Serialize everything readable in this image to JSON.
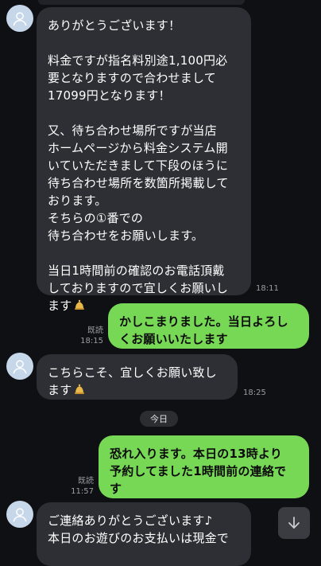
{
  "messages": [
    {
      "side": "in",
      "lines": [
        "ありがとうございます！",
        "",
        "料金ですが指名料別途1,100円必",
        "要となりますので合わせまして",
        "17099円となります！",
        "",
        "又、待ち合わせ場所ですが当店",
        "ホームページから料金システム開",
        "いていただきまして下段のほうに",
        "待ち合わせ場所を数箇所掲載して",
        "おります。",
        "そちらの①番での",
        "待ち合わせをお願いします。",
        "",
        "当日1時間前の確認のお電話頂戴",
        "しておりますので宜しくお願いし",
        "ます"
      ],
      "time": "18:11",
      "emoji": "bell-emoji"
    },
    {
      "side": "out",
      "lines": [
        "かしこまりました。当日よろし",
        "くお願いいたします"
      ],
      "read": "既読",
      "time": "18:15"
    },
    {
      "side": "in",
      "lines": [
        "こちらこそ、宜しくお願い致し",
        "ます"
      ],
      "time": "18:25",
      "emoji": "bell-emoji"
    },
    {
      "side": "out",
      "lines": [
        "恐れ入ります。本日の13時より",
        "予約してました1時間前の連絡で",
        "す"
      ],
      "read": "既読",
      "time": "11:57"
    },
    {
      "side": "in",
      "lines": [
        "ご連絡ありがとうございます♪",
        "本日のお遊びのお支払いは現金で"
      ]
    }
  ],
  "date_divider": "今日",
  "icons": {
    "avatar": "person-silhouette-icon",
    "scroll": "chevron-down-icon"
  },
  "colors": {
    "background": "#0f1013",
    "incoming_bubble": "#2d2f34",
    "outgoing_bubble": "#77d856"
  }
}
